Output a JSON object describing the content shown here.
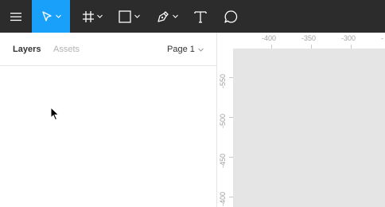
{
  "toolbar": {
    "tools": [
      {
        "name": "main-menu",
        "icon": "hamburger-menu-icon"
      },
      {
        "name": "move-tool",
        "icon": "move-arrow-icon",
        "active": true
      },
      {
        "name": "frame-tool",
        "icon": "frame-hash-icon"
      },
      {
        "name": "shape-tool",
        "icon": "rectangle-icon"
      },
      {
        "name": "pen-tool",
        "icon": "pen-icon"
      },
      {
        "name": "text-tool",
        "icon": "text-icon"
      },
      {
        "name": "comment-tool",
        "icon": "comment-bubble-icon"
      }
    ],
    "active_color": "#18a0fb",
    "background_color": "#2c2c2c"
  },
  "panel": {
    "tabs": {
      "layers": "Layers",
      "assets": "Assets"
    },
    "page_select": "Page 1"
  },
  "canvas": {
    "ruler_top": [
      "-400",
      "-350",
      "-300",
      "-"
    ],
    "ruler_left": [
      "-550",
      "-500",
      "-450",
      "-400"
    ],
    "background_color": "#e5e5e5"
  }
}
